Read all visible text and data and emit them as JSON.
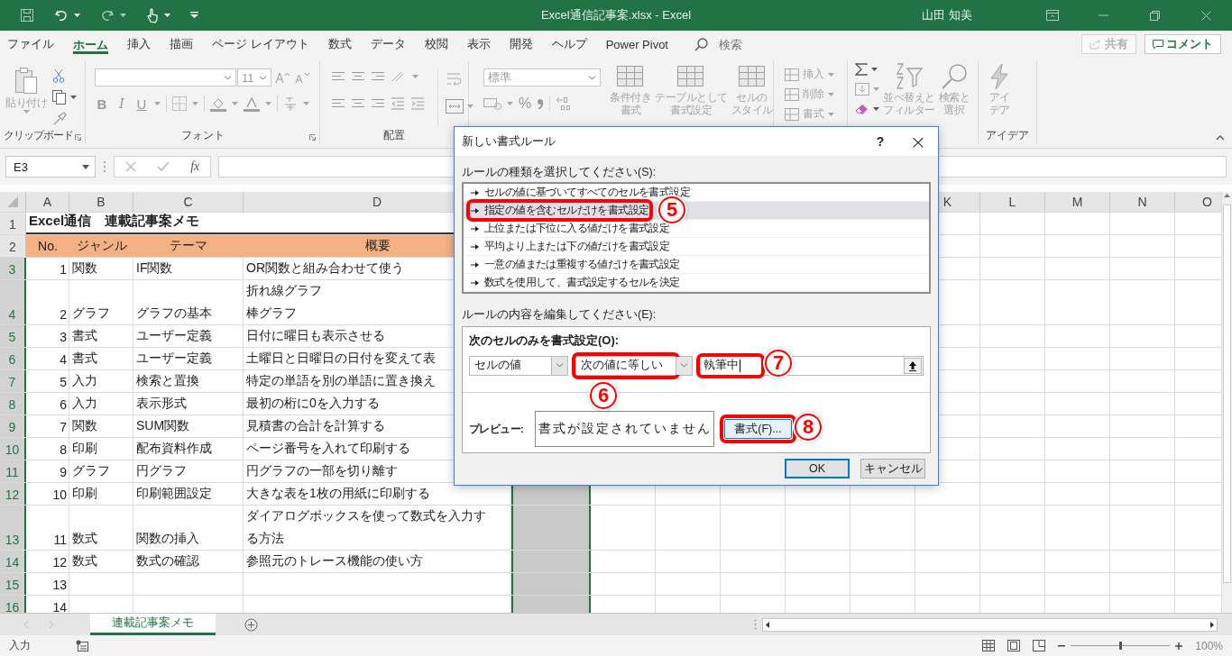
{
  "title_bar": {
    "title": "Excel通信記事案.xlsx  -  Excel",
    "user": "山田 知美"
  },
  "menu_tabs": [
    {
      "label": "ファイル",
      "selected": false
    },
    {
      "label": "ホーム",
      "selected": true
    },
    {
      "label": "挿入",
      "selected": false
    },
    {
      "label": "描画",
      "selected": false
    },
    {
      "label": "ページ レイアウト",
      "selected": false
    },
    {
      "label": "数式",
      "selected": false
    },
    {
      "label": "データ",
      "selected": false
    },
    {
      "label": "校閲",
      "selected": false
    },
    {
      "label": "表示",
      "selected": false
    },
    {
      "label": "開発",
      "selected": false
    },
    {
      "label": "ヘルプ",
      "selected": false
    },
    {
      "label": "Power Pivot",
      "selected": false
    }
  ],
  "tell_me": {
    "placeholder": "検索"
  },
  "share_button": "共有",
  "comment_button": "コメント",
  "ribbon": {
    "clipboard": {
      "paste": "貼り付け",
      "label": "クリップボード"
    },
    "font": {
      "size": "11",
      "bold": "B",
      "italic": "I",
      "underline": "U",
      "label": "フォント"
    },
    "alignment": {
      "label": "配置"
    },
    "number": {
      "format": "標準",
      "percent": "%"
    },
    "styles": [
      {
        "lines": [
          "条件付き",
          "書式"
        ]
      },
      {
        "lines": [
          "テーブルとして",
          "書式設定"
        ]
      },
      {
        "lines": [
          "セルの",
          "スタイル"
        ]
      }
    ],
    "cells": [
      "挿入",
      "削除",
      "書式"
    ],
    "editing": [
      {
        "lines": [
          "並べ替えと",
          "フィルター"
        ]
      },
      {
        "lines": [
          "検索と",
          "選択"
        ]
      }
    ],
    "ideas": {
      "lines": [
        "アイ",
        "デア"
      ],
      "label": "アイデア"
    }
  },
  "formula_bar": {
    "name_box": "E3",
    "fx": "fx"
  },
  "sheet": {
    "columns_left": [
      "A",
      "B",
      "C",
      "D"
    ],
    "columns_right": [
      "K",
      "L",
      "M",
      "N",
      "O"
    ],
    "rows": [
      {
        "header": "1",
        "kind": "title",
        "selected": false,
        "text": "Excel通信　連載記事案メモ"
      },
      {
        "header": "2",
        "kind": "heading",
        "selected": false,
        "cells": [
          "No.",
          "ジャンル",
          "テーマ",
          "概要"
        ]
      },
      {
        "header": "3",
        "kind": "data",
        "selected": true,
        "cells": [
          "1",
          "関数",
          "IF関数"
        ],
        "summary": [
          "OR関数と組み合わせて使う"
        ]
      },
      {
        "header": "4",
        "kind": "tall",
        "selected": true,
        "cells": [
          "2",
          "グラフ",
          "グラフの基本"
        ],
        "summary": [
          "折れ線グラフ",
          "棒グラフ"
        ]
      },
      {
        "header": "5",
        "kind": "data",
        "selected": true,
        "cells": [
          "3",
          "書式",
          "ユーザー定義"
        ],
        "summary": [
          "日付に曜日も表示させる"
        ]
      },
      {
        "header": "6",
        "kind": "data",
        "selected": true,
        "cells": [
          "4",
          "書式",
          "ユーザー定義"
        ],
        "summary": [
          "土曜日と日曜日の日付を変えて表"
        ]
      },
      {
        "header": "7",
        "kind": "data",
        "selected": true,
        "cells": [
          "5",
          "入力",
          "検索と置換"
        ],
        "summary": [
          "特定の単語を別の単語に置き換え"
        ]
      },
      {
        "header": "8",
        "kind": "data",
        "selected": true,
        "cells": [
          "6",
          "入力",
          "表示形式"
        ],
        "summary": [
          "最初の桁に0を入力する"
        ]
      },
      {
        "header": "9",
        "kind": "data",
        "selected": true,
        "cells": [
          "7",
          "関数",
          "SUM関数"
        ],
        "summary": [
          "見積書の合計を計算する"
        ]
      },
      {
        "header": "10",
        "kind": "data",
        "selected": true,
        "cells": [
          "8",
          "印刷",
          "配布資料作成"
        ],
        "summary": [
          "ページ番号を入れて印刷する"
        ]
      },
      {
        "header": "11",
        "kind": "data",
        "selected": true,
        "cells": [
          "9",
          "グラフ",
          "円グラフ"
        ],
        "summary": [
          "円グラフの一部を切り離す"
        ]
      },
      {
        "header": "12",
        "kind": "data",
        "selected": true,
        "cells": [
          "10",
          "印刷",
          "印刷範囲設定"
        ],
        "summary": [
          "大きな表を1枚の用紙に印刷する"
        ]
      },
      {
        "header": "13",
        "kind": "tall",
        "selected": true,
        "cells": [
          "11",
          "数式",
          "関数の挿入"
        ],
        "summary": [
          "ダイアログボックスを使って数式を入力す",
          "る方法"
        ]
      },
      {
        "header": "14",
        "kind": "data",
        "selected": true,
        "cells": [
          "12",
          "数式",
          "数式の確認"
        ],
        "summary": [
          "参照元のトレース機能の使い方"
        ]
      },
      {
        "header": "15",
        "kind": "data",
        "selected": true,
        "cells": [
          "13"
        ]
      },
      {
        "header": "16",
        "kind": "data",
        "selected": true,
        "cells": [
          "14"
        ]
      }
    ]
  },
  "sheet_tabs": [
    {
      "label": "連載記事案メモ",
      "selected": true
    }
  ],
  "status_bar": {
    "mode": "入力",
    "zoom": {
      "level": 0.5,
      "reading": "100%"
    }
  },
  "dialog": {
    "title": "新しい書式ルール",
    "help": "?",
    "close": "×",
    "type_label": "ルールの種類を選択してください(S):",
    "rule_types": [
      {
        "label": "セルの値に基づいてすべてのセルを書式設定",
        "selected": false,
        "highlighted": false
      },
      {
        "label": "指定の値を含むセルだけを書式設定",
        "selected": true,
        "highlighted": true,
        "step": "5"
      },
      {
        "label": "上位または下位に入る値だけを書式設定",
        "selected": false,
        "highlighted": false
      },
      {
        "label": "平均より上または下の値だけを書式設定",
        "selected": false,
        "highlighted": false
      },
      {
        "label": "一意の値または重複する値だけを書式設定",
        "selected": false,
        "highlighted": false
      },
      {
        "label": "数式を使用して、書式設定するセルを決定",
        "selected": false,
        "highlighted": false
      }
    ],
    "edit_label": "ルールの内容を編集してください(E):",
    "condition_heading": "次のセルのみを書式設定(O):",
    "subject": {
      "value": "セルの値",
      "highlighted": false
    },
    "operator": {
      "value": "次の値に等しい",
      "highlighted": true,
      "step": "6"
    },
    "value_field": {
      "value": "執筆中",
      "highlighted": true,
      "step": "7"
    },
    "preview_label": "プレビュー:",
    "preview_text": "書式が設定されていません",
    "format_button": {
      "label": "書式(F)...",
      "highlighted": true,
      "step": "8"
    },
    "ok": "OK",
    "cancel": "キャンセル"
  }
}
